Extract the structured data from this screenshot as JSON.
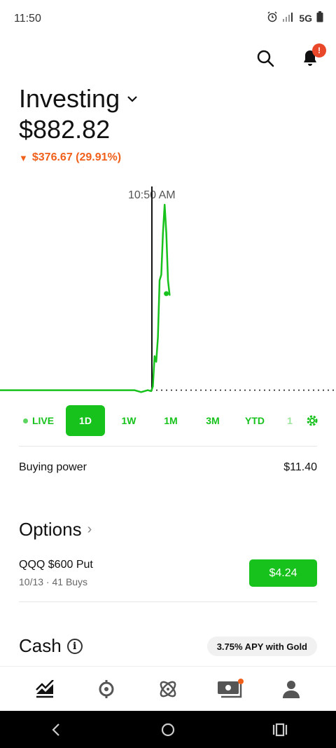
{
  "status_bar": {
    "time": "11:50",
    "network": "5G"
  },
  "header": {
    "account_title": "Investing",
    "balance": "$882.82",
    "change": "$376.67 (29.91%)"
  },
  "chart_data": {
    "type": "line",
    "cursor_label": "10:50 AM",
    "x_range": [
      0,
      100
    ],
    "y_range": [
      0,
      100
    ],
    "baseline": 2,
    "points": [
      [
        0,
        2
      ],
      [
        40,
        2
      ],
      [
        42,
        1
      ],
      [
        44,
        2
      ],
      [
        45,
        1.5
      ],
      [
        45.5,
        4
      ],
      [
        46,
        20
      ],
      [
        46.5,
        17
      ],
      [
        47,
        30
      ],
      [
        47.5,
        60
      ],
      [
        48,
        63
      ],
      [
        48.5,
        85
      ],
      [
        49,
        100
      ],
      [
        49.5,
        85
      ],
      [
        50,
        60
      ],
      [
        50.5,
        52
      ]
    ],
    "end_marker": [
      49.5,
      53
    ],
    "line_color": "#17c21c"
  },
  "ranges": {
    "live": "LIVE",
    "items": [
      "1D",
      "1W",
      "1M",
      "3M",
      "YTD"
    ],
    "partial": "1",
    "active": "1D"
  },
  "buying_power": {
    "label": "Buying power",
    "value": "$11.40"
  },
  "options": {
    "title": "Options",
    "item": {
      "name": "QQQ $600 Put",
      "meta": "10/13 · 41 Buys",
      "price": "$4.24"
    }
  },
  "cash": {
    "title": "Cash",
    "apy": "3.75% APY with Gold"
  },
  "bottom_nav": [
    "chart-icon",
    "crypto-icon",
    "atom-icon",
    "cash-icon",
    "profile-icon"
  ]
}
